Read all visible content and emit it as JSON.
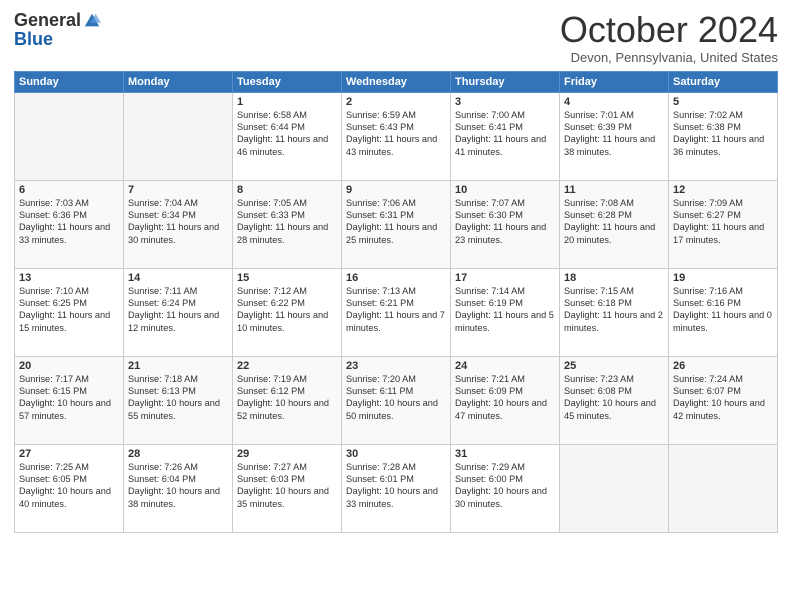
{
  "logo": {
    "general": "General",
    "blue": "Blue"
  },
  "title": "October 2024",
  "location": "Devon, Pennsylvania, United States",
  "days_of_week": [
    "Sunday",
    "Monday",
    "Tuesday",
    "Wednesday",
    "Thursday",
    "Friday",
    "Saturday"
  ],
  "weeks": [
    [
      {
        "day": "",
        "info": ""
      },
      {
        "day": "",
        "info": ""
      },
      {
        "day": "1",
        "info": "Sunrise: 6:58 AM\nSunset: 6:44 PM\nDaylight: 11 hours and 46 minutes."
      },
      {
        "day": "2",
        "info": "Sunrise: 6:59 AM\nSunset: 6:43 PM\nDaylight: 11 hours and 43 minutes."
      },
      {
        "day": "3",
        "info": "Sunrise: 7:00 AM\nSunset: 6:41 PM\nDaylight: 11 hours and 41 minutes."
      },
      {
        "day": "4",
        "info": "Sunrise: 7:01 AM\nSunset: 6:39 PM\nDaylight: 11 hours and 38 minutes."
      },
      {
        "day": "5",
        "info": "Sunrise: 7:02 AM\nSunset: 6:38 PM\nDaylight: 11 hours and 36 minutes."
      }
    ],
    [
      {
        "day": "6",
        "info": "Sunrise: 7:03 AM\nSunset: 6:36 PM\nDaylight: 11 hours and 33 minutes."
      },
      {
        "day": "7",
        "info": "Sunrise: 7:04 AM\nSunset: 6:34 PM\nDaylight: 11 hours and 30 minutes."
      },
      {
        "day": "8",
        "info": "Sunrise: 7:05 AM\nSunset: 6:33 PM\nDaylight: 11 hours and 28 minutes."
      },
      {
        "day": "9",
        "info": "Sunrise: 7:06 AM\nSunset: 6:31 PM\nDaylight: 11 hours and 25 minutes."
      },
      {
        "day": "10",
        "info": "Sunrise: 7:07 AM\nSunset: 6:30 PM\nDaylight: 11 hours and 23 minutes."
      },
      {
        "day": "11",
        "info": "Sunrise: 7:08 AM\nSunset: 6:28 PM\nDaylight: 11 hours and 20 minutes."
      },
      {
        "day": "12",
        "info": "Sunrise: 7:09 AM\nSunset: 6:27 PM\nDaylight: 11 hours and 17 minutes."
      }
    ],
    [
      {
        "day": "13",
        "info": "Sunrise: 7:10 AM\nSunset: 6:25 PM\nDaylight: 11 hours and 15 minutes."
      },
      {
        "day": "14",
        "info": "Sunrise: 7:11 AM\nSunset: 6:24 PM\nDaylight: 11 hours and 12 minutes."
      },
      {
        "day": "15",
        "info": "Sunrise: 7:12 AM\nSunset: 6:22 PM\nDaylight: 11 hours and 10 minutes."
      },
      {
        "day": "16",
        "info": "Sunrise: 7:13 AM\nSunset: 6:21 PM\nDaylight: 11 hours and 7 minutes."
      },
      {
        "day": "17",
        "info": "Sunrise: 7:14 AM\nSunset: 6:19 PM\nDaylight: 11 hours and 5 minutes."
      },
      {
        "day": "18",
        "info": "Sunrise: 7:15 AM\nSunset: 6:18 PM\nDaylight: 11 hours and 2 minutes."
      },
      {
        "day": "19",
        "info": "Sunrise: 7:16 AM\nSunset: 6:16 PM\nDaylight: 11 hours and 0 minutes."
      }
    ],
    [
      {
        "day": "20",
        "info": "Sunrise: 7:17 AM\nSunset: 6:15 PM\nDaylight: 10 hours and 57 minutes."
      },
      {
        "day": "21",
        "info": "Sunrise: 7:18 AM\nSunset: 6:13 PM\nDaylight: 10 hours and 55 minutes."
      },
      {
        "day": "22",
        "info": "Sunrise: 7:19 AM\nSunset: 6:12 PM\nDaylight: 10 hours and 52 minutes."
      },
      {
        "day": "23",
        "info": "Sunrise: 7:20 AM\nSunset: 6:11 PM\nDaylight: 10 hours and 50 minutes."
      },
      {
        "day": "24",
        "info": "Sunrise: 7:21 AM\nSunset: 6:09 PM\nDaylight: 10 hours and 47 minutes."
      },
      {
        "day": "25",
        "info": "Sunrise: 7:23 AM\nSunset: 6:08 PM\nDaylight: 10 hours and 45 minutes."
      },
      {
        "day": "26",
        "info": "Sunrise: 7:24 AM\nSunset: 6:07 PM\nDaylight: 10 hours and 42 minutes."
      }
    ],
    [
      {
        "day": "27",
        "info": "Sunrise: 7:25 AM\nSunset: 6:05 PM\nDaylight: 10 hours and 40 minutes."
      },
      {
        "day": "28",
        "info": "Sunrise: 7:26 AM\nSunset: 6:04 PM\nDaylight: 10 hours and 38 minutes."
      },
      {
        "day": "29",
        "info": "Sunrise: 7:27 AM\nSunset: 6:03 PM\nDaylight: 10 hours and 35 minutes."
      },
      {
        "day": "30",
        "info": "Sunrise: 7:28 AM\nSunset: 6:01 PM\nDaylight: 10 hours and 33 minutes."
      },
      {
        "day": "31",
        "info": "Sunrise: 7:29 AM\nSunset: 6:00 PM\nDaylight: 10 hours and 30 minutes."
      },
      {
        "day": "",
        "info": ""
      },
      {
        "day": "",
        "info": ""
      }
    ]
  ]
}
